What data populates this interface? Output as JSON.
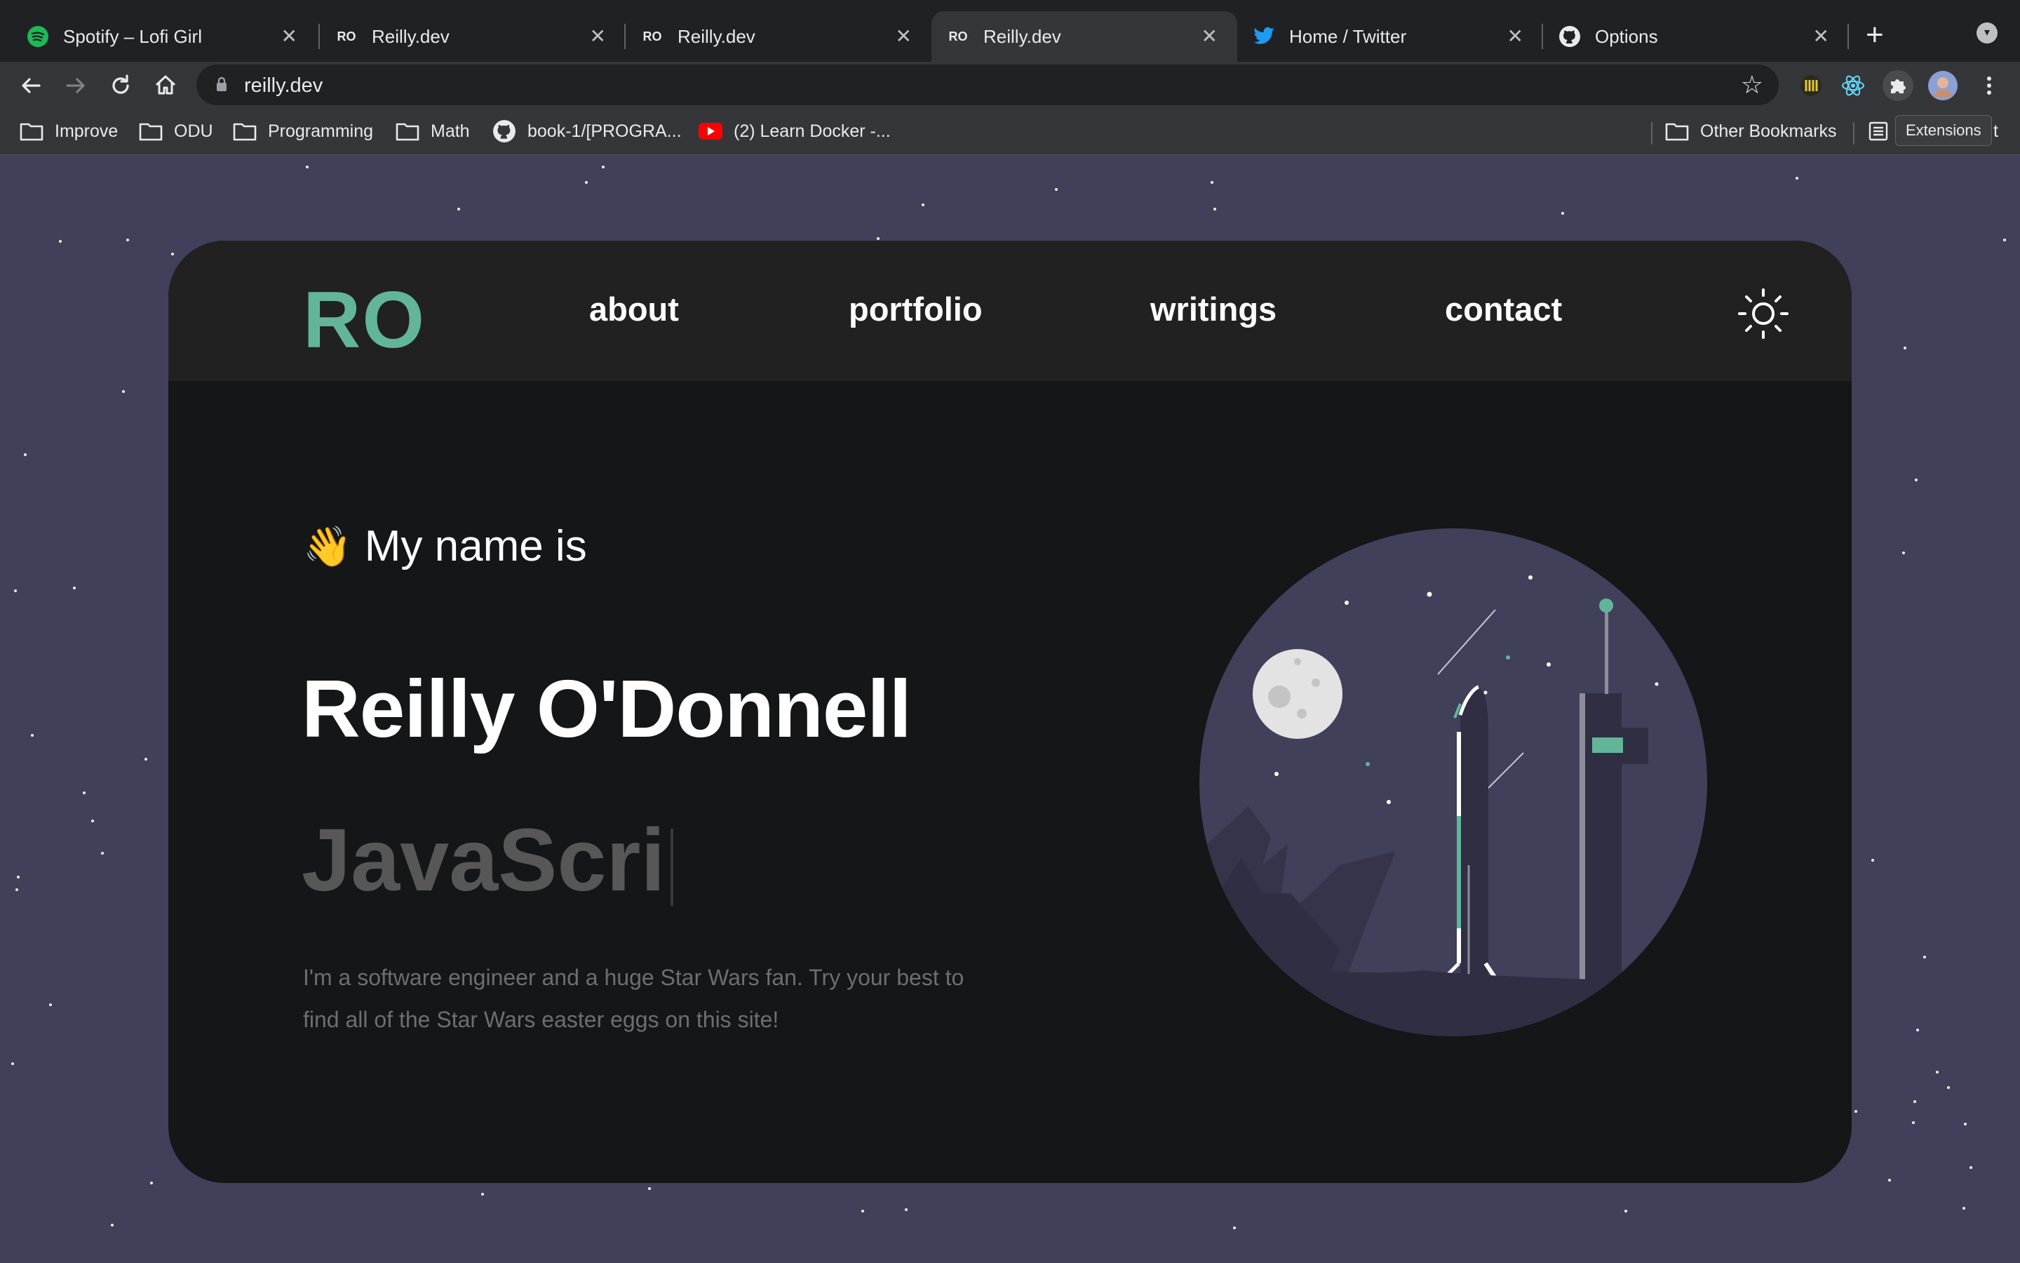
{
  "browser": {
    "tabs": [
      {
        "title": "Spotify – Lofi Girl",
        "favicon": "spotify-icon",
        "active": false
      },
      {
        "title": "Reilly.dev",
        "favicon": "ro-icon",
        "active": false
      },
      {
        "title": "Reilly.dev",
        "favicon": "ro-icon",
        "active": false
      },
      {
        "title": "Reilly.dev",
        "favicon": "ro-icon",
        "active": true
      },
      {
        "title": "Home / Twitter",
        "favicon": "twitter-icon",
        "active": false
      },
      {
        "title": "Options",
        "favicon": "github-icon",
        "active": false
      }
    ],
    "favicon_text": "RO",
    "close_glyph": "✕",
    "new_tab_glyph": "+",
    "url": "reilly.dev",
    "bookmarks": [
      {
        "label": "Improve",
        "icon": "folder-icon"
      },
      {
        "label": "ODU",
        "icon": "folder-icon"
      },
      {
        "label": "Programming",
        "icon": "folder-icon"
      },
      {
        "label": "Math",
        "icon": "folder-icon"
      },
      {
        "label": "book-1/[PROGRA...",
        "icon": "github-icon"
      },
      {
        "label": "(2) Learn Docker -...",
        "icon": "youtube-icon"
      }
    ],
    "other_bookmarks": "Other Bookmarks",
    "reading_list_tooltip": "Extensions",
    "tooltip_tail": "t",
    "colors": {
      "tabbar": "#202124",
      "toolbar": "#35363a",
      "text": "#e8eaed"
    }
  },
  "site": {
    "logo": "RO",
    "nav": [
      "about",
      "portfolio",
      "writings",
      "contact"
    ],
    "theme_toggle": "sun-icon",
    "greeting_emoji": "👋",
    "greeting": "My name is",
    "name": "Reilly O'Donnell",
    "typed_text": "JavaScri",
    "bio": "I'm a software engineer and a huge Star Wars fan. Try your best to find all of the Star Wars easter eggs on this site!",
    "colors": {
      "accent": "#63b59a",
      "background": "#41405a",
      "card": "#141617",
      "nav": "#212121"
    }
  }
}
